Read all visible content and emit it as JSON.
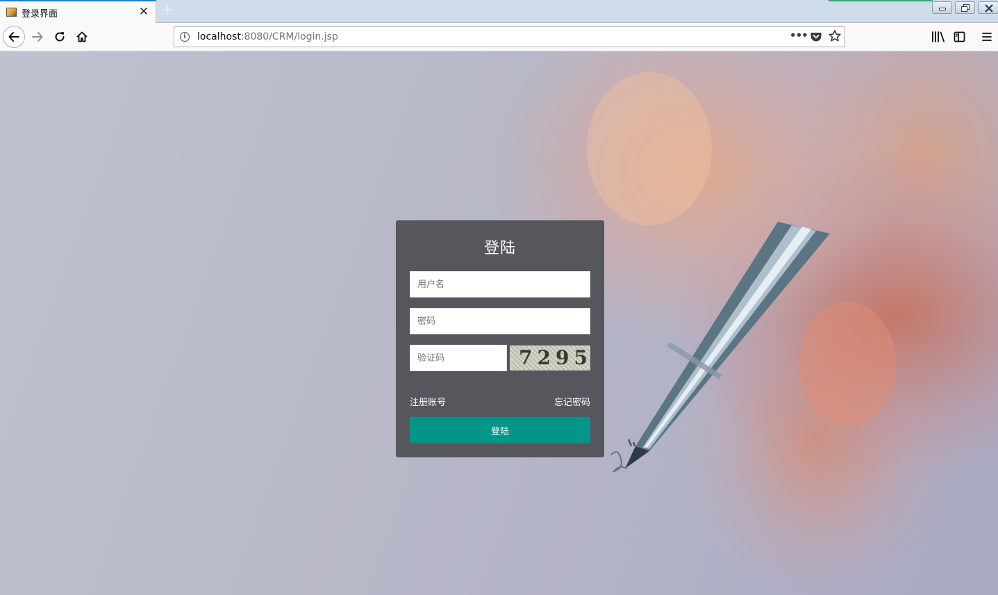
{
  "browser": {
    "tab": {
      "title": "登录界面",
      "close_glyph": "✕",
      "favicon": "page-favicon-icon"
    },
    "new_tab_glyph": "+",
    "url": {
      "host": "localhost",
      "rest": ":8080/CRM/login.jsp",
      "more_glyph": "•••"
    },
    "icons": {
      "back": "back-arrow-icon",
      "forward": "forward-arrow-icon",
      "reload": "reload-icon",
      "home": "home-icon",
      "site_info": "info-icon",
      "pocket": "pocket-icon",
      "bookmark": "star-icon",
      "library": "library-icon",
      "sidebar": "sidebar-icon",
      "menu": "hamburger-menu-icon"
    },
    "window_controls": [
      "minimize",
      "restore",
      "close"
    ]
  },
  "login": {
    "title": "登陆",
    "username_placeholder": "用户名",
    "password_placeholder": "密码",
    "captcha_placeholder": "验证码",
    "captcha_image_text": "7295",
    "register_link": "注册账号",
    "forgot_link": "忘记密码",
    "submit_label": "登陆"
  },
  "colors": {
    "card_background": "#56575d",
    "button_background": "#009688",
    "tab_accent": "#0a84ff"
  }
}
